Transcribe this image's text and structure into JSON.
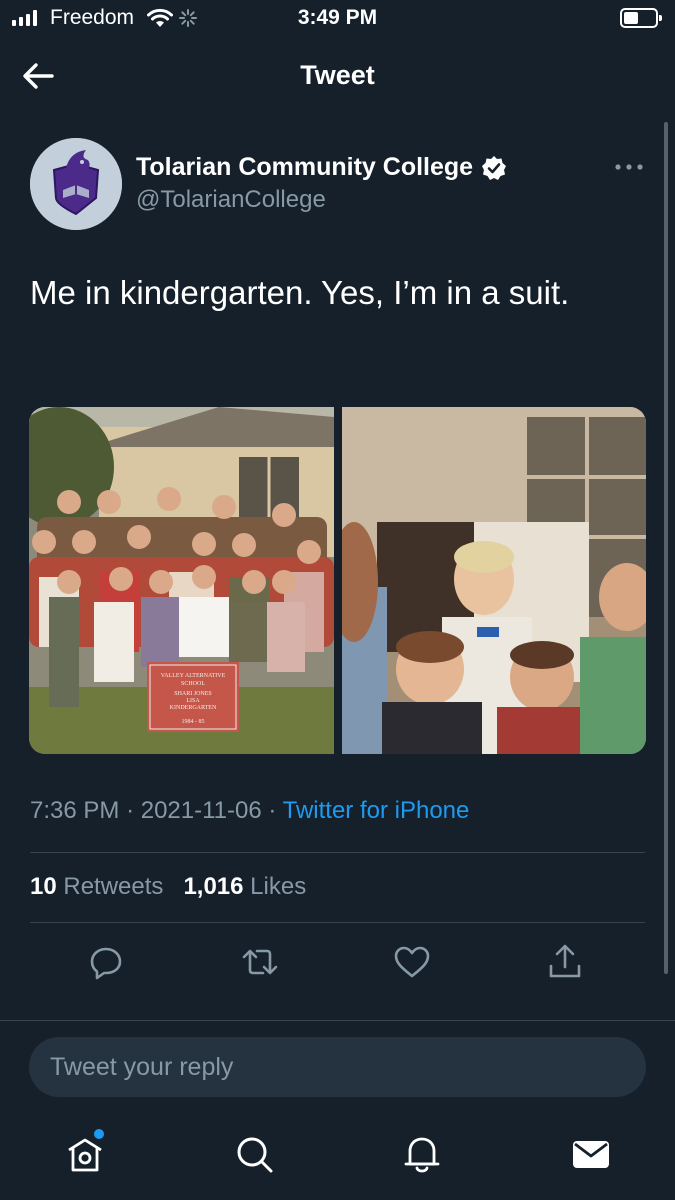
{
  "status_bar": {
    "carrier": "Freedom",
    "time": "3:49 PM"
  },
  "header": {
    "title": "Tweet"
  },
  "tweet": {
    "author_name": "Tolarian Community College",
    "author_handle": "@TolarianCollege",
    "verified": true,
    "text": "Me in kindergarten. Yes, I’m in a suit.",
    "photos": [
      {
        "sign_lines": [
          "VALLEY ALTERNATIVE",
          "SCHOOL",
          "SHARI JONES",
          "LISA",
          "KINDERGARTEN",
          "1984 - 85"
        ]
      },
      {}
    ],
    "time": "7:36 PM",
    "separator": "·",
    "date": "2021-11-06",
    "source": "Twitter for iPhone",
    "retweets_count": "10",
    "retweets_label": "Retweets",
    "likes_count": "1,016",
    "likes_label": "Likes"
  },
  "actions": {
    "icons": [
      "reply-icon",
      "retweet-icon",
      "like-icon",
      "share-icon"
    ]
  },
  "reply": {
    "placeholder": "Tweet your reply"
  },
  "tabbar": {
    "icons": [
      "home-icon",
      "search-icon",
      "notifications-icon",
      "messages-icon"
    ],
    "unread_dot_color": "#1d9bf0"
  },
  "colors": {
    "background": "#15202b",
    "secondary_text": "#8899a6",
    "accent": "#1d9bf0",
    "divider": "#38444d"
  }
}
